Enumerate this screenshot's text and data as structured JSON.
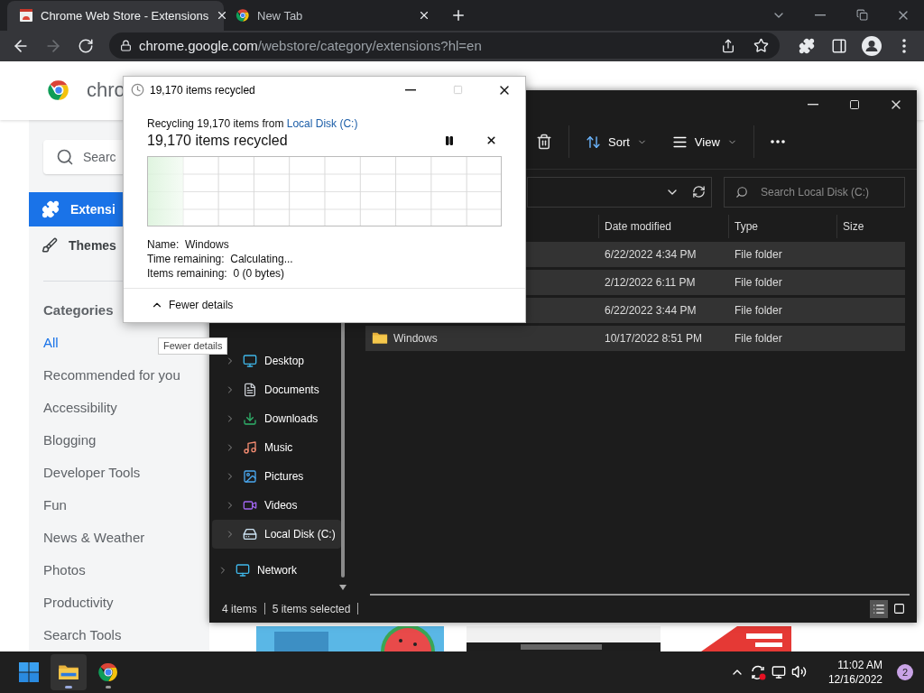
{
  "browser": {
    "tabs": [
      {
        "title": "Chrome Web Store - Extensions",
        "selected": true,
        "kind": "store"
      },
      {
        "title": "New Tab",
        "selected": false,
        "kind": "chrome"
      }
    ],
    "nav_buttons": [
      {
        "kind": "back",
        "disabled": false
      },
      {
        "kind": "forward",
        "disabled": true
      },
      {
        "kind": "reload",
        "disabled": false
      }
    ],
    "url": {
      "host": "chrome.google.com",
      "path": "/webstore/category/extensions?hl=en"
    }
  },
  "store": {
    "logo_text": "chro",
    "search": {
      "placeholder": "Searc"
    },
    "nav": [
      {
        "label": "Extensi",
        "selected": true,
        "kind": "extensions"
      },
      {
        "label": "Themes",
        "selected": false,
        "kind": "themes"
      }
    ],
    "categories_title": "Categories",
    "categories": [
      {
        "label": "All",
        "selected": true
      },
      {
        "label": "Recommended for you",
        "selected": false
      },
      {
        "label": "Accessibility",
        "selected": false
      },
      {
        "label": "Blogging",
        "selected": false
      },
      {
        "label": "Developer Tools",
        "selected": false
      },
      {
        "label": "Fun",
        "selected": false
      },
      {
        "label": "News & Weather",
        "selected": false
      },
      {
        "label": "Photos",
        "selected": false
      },
      {
        "label": "Productivity",
        "selected": false
      },
      {
        "label": "Search Tools",
        "selected": false
      }
    ]
  },
  "explorer": {
    "commands": [
      {
        "label": "Sort",
        "kind": "sort"
      },
      {
        "label": "View",
        "kind": "view"
      }
    ],
    "search": {
      "placeholder": "Search Local Disk (C:)"
    },
    "columns": [
      "Date modified",
      "Type",
      "Size"
    ],
    "rows": [
      {
        "date": "6/22/2022 4:34 PM",
        "type": "File folder",
        "selected": true
      },
      {
        "date": "2/12/2022 6:11 PM",
        "type": "File folder",
        "selected": true
      },
      {
        "date": "6/22/2022 3:44 PM",
        "type": "File folder",
        "selected": true
      },
      {
        "name": "Windows",
        "date": "10/17/2022 8:51 PM",
        "type": "File folder",
        "selected": true
      }
    ],
    "nav": [
      {
        "label": "Desktop",
        "kind": "desktop",
        "selected": false
      },
      {
        "label": "Documents",
        "kind": "documents",
        "selected": false
      },
      {
        "label": "Downloads",
        "kind": "downloads",
        "selected": false
      },
      {
        "label": "Music",
        "kind": "music",
        "selected": false
      },
      {
        "label": "Pictures",
        "kind": "pictures",
        "selected": false
      },
      {
        "label": "Videos",
        "kind": "videos",
        "selected": false
      },
      {
        "label": "Local Disk (C:)",
        "kind": "disk",
        "selected": true
      }
    ],
    "network": "Network",
    "status": {
      "count": "4 items",
      "selection": "5 items selected"
    }
  },
  "dialog": {
    "title": "19,170 items recycled",
    "maximize_disabled": true,
    "summary": "Recycling 19,170 items from",
    "source": "Local Disk (C:)",
    "heading": "19,170 items recycled",
    "progress": {
      "level": 0.1
    },
    "details": [
      {
        "label": "Name:",
        "value": "Windows"
      },
      {
        "label": "Time remaining:",
        "value": "Calculating..."
      },
      {
        "label": "Items remaining:",
        "value": "0 (0 bytes)"
      }
    ],
    "toggle": "Fewer details"
  },
  "tooltip": "Fewer details",
  "taskbar": {
    "apps": [
      {
        "kind": "explorer",
        "selected": true
      },
      {
        "kind": "chrome",
        "selected": false
      }
    ],
    "time": "11:02 AM",
    "date": "12/16/2022",
    "notifications": "2"
  }
}
